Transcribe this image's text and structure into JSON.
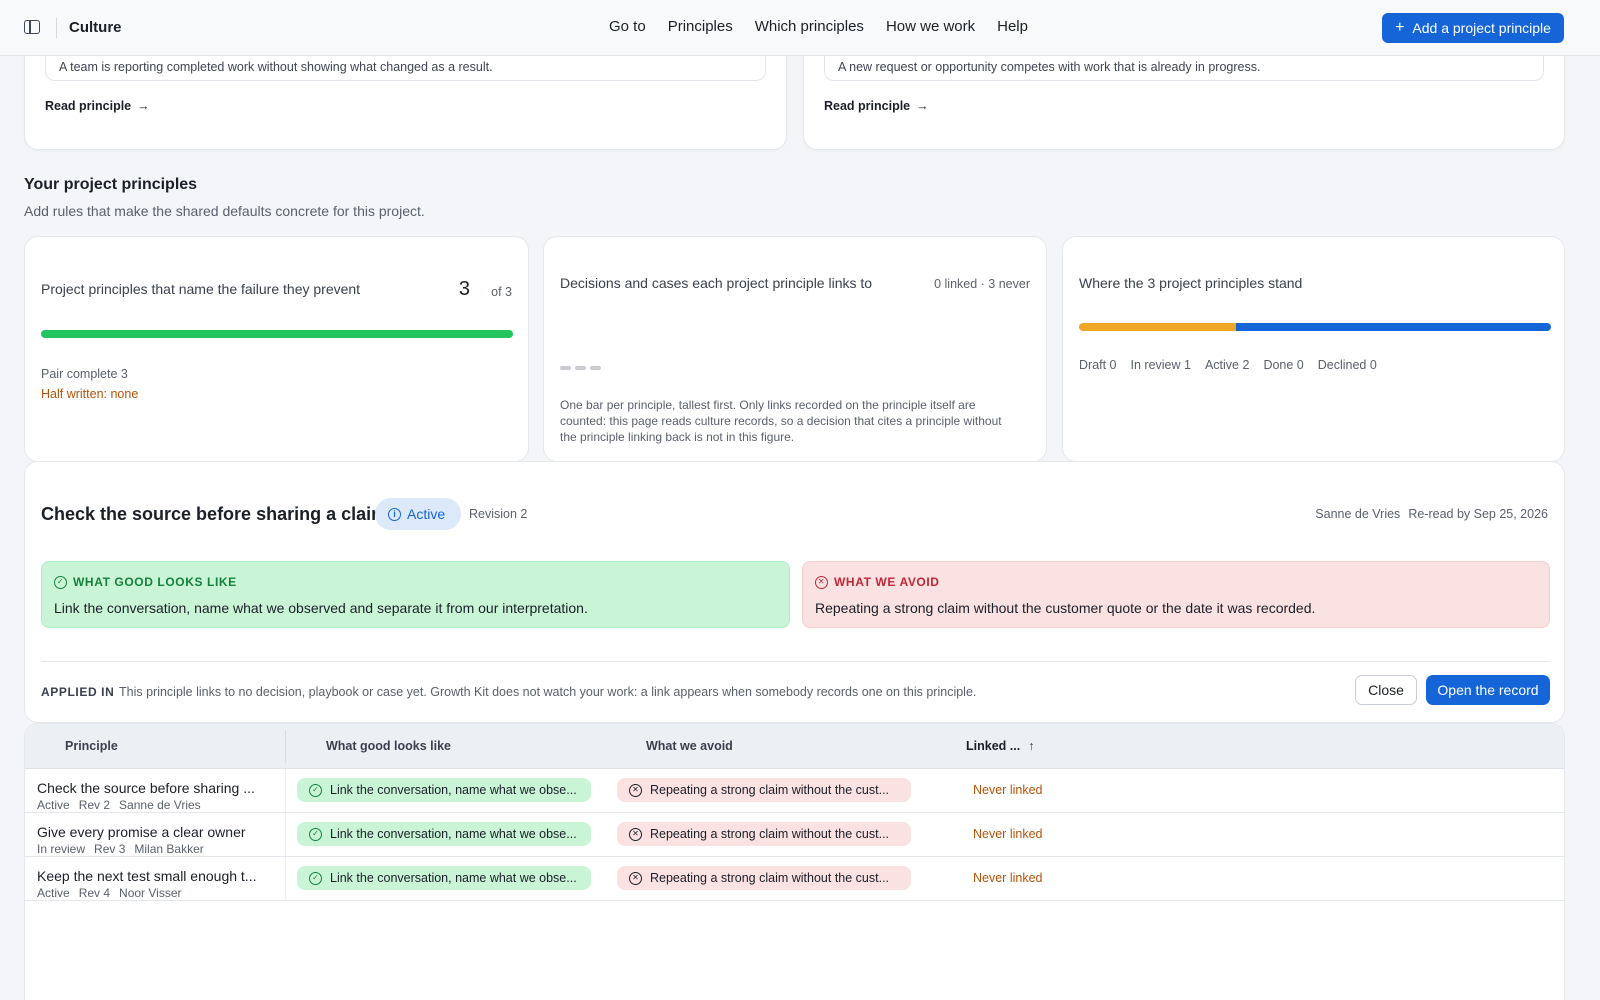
{
  "topbar": {
    "app_title": "Culture",
    "nav": [
      "Go to",
      "Principles",
      "Which principles",
      "How we work",
      "Help"
    ],
    "add_button": "Add a project principle"
  },
  "top_cards": [
    {
      "text": "A team is reporting completed work without showing what changed as a result.",
      "link": "Read principle"
    },
    {
      "text": "A new request or opportunity competes with work that is already in progress.",
      "link": "Read principle"
    }
  ],
  "section": {
    "title": "Your project principles",
    "subtitle": "Add rules that make the shared defaults concrete for this project."
  },
  "stats": {
    "failure": {
      "title": "Project principles that name the failure they prevent",
      "count": "3",
      "of": "of 3",
      "progress": 1.0,
      "pair_complete": "Pair complete 3",
      "half_written": "Half written: none"
    },
    "links": {
      "title": "Decisions and cases each project principle links to",
      "meta": "0 linked · 3 never",
      "description": "One bar per principle, tallest first. Only links recorded on the principle itself are counted: this page reads culture records, so a decision that cites a principle without the principle linking back is not in this figure."
    },
    "status": {
      "title": "Where the 3 project principles stand",
      "legend": [
        "Draft 0",
        "In review 1",
        "Active 2",
        "Done 0",
        "Declined 0"
      ],
      "counts": {
        "draft": 0,
        "in_review": 1,
        "active": 2,
        "done": 0,
        "declined": 0
      }
    }
  },
  "detail": {
    "title": "Check the source before sharing a claim",
    "status": "Active",
    "revision": "Revision 2",
    "owner": "Sanne de Vries",
    "reread": "Re-read by Sep 25, 2026",
    "good_label": "WHAT GOOD LOOKS LIKE",
    "good_text": "Link the conversation, name what we observed and separate it from our interpretation.",
    "avoid_label": "WHAT WE AVOID",
    "avoid_text": "Repeating a strong claim without the customer quote or the date it was recorded.",
    "applied_label": "APPLIED IN",
    "applied_text": "This principle links to no decision, playbook or case yet. Growth Kit does not watch your work: a link appears when somebody records one on this principle.",
    "close_label": "Close",
    "open_label": "Open the record"
  },
  "table": {
    "headers": [
      "Principle",
      "What good looks like",
      "What we avoid",
      "Linked ..."
    ],
    "rows": [
      {
        "title": "Check the source before sharing ...",
        "status": "Active",
        "rev": "Rev 2",
        "owner": "Sanne de Vries",
        "good": "Link the conversation, name what we obse...",
        "avoid": "Repeating a strong claim without the cust...",
        "linked": "Never linked"
      },
      {
        "title": "Give every promise a clear owner",
        "status": "In review",
        "rev": "Rev 3",
        "owner": "Milan Bakker",
        "good": "Link the conversation, name what we obse...",
        "avoid": "Repeating a strong claim without the cust...",
        "linked": "Never linked"
      },
      {
        "title": "Keep the next test small enough t...",
        "status": "Active",
        "rev": "Rev 4",
        "owner": "Noor Visser",
        "good": "Link the conversation, name what we obse...",
        "avoid": "Repeating a strong claim without the cust...",
        "linked": "Never linked"
      }
    ]
  },
  "colors": {
    "accent": "#1565d8",
    "good": "#c9f5d6",
    "avoid": "#fbe2e2",
    "progress": "#22c55e",
    "review": "#f0a626"
  }
}
